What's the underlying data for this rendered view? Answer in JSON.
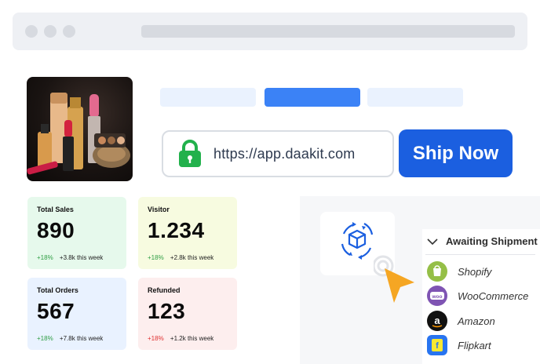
{
  "url_field": {
    "value": "https://app.daakit.com"
  },
  "ship_button": {
    "label": "Ship Now"
  },
  "stats": [
    {
      "label": "Total Sales",
      "value": "890",
      "change": "+18%",
      "change_color": "#2f9e44",
      "note": "+3.8k this week",
      "bg": "#e6f9ec"
    },
    {
      "label": "Visitor",
      "value": "1.234",
      "change": "+18%",
      "change_color": "#2f9e44",
      "note": "+2.8k this week",
      "bg": "#f7fbe0"
    },
    {
      "label": "Total Orders",
      "value": "567",
      "change": "+18%",
      "change_color": "#2f9e44",
      "note": "+7.8k this week",
      "bg": "#e9f2ff"
    },
    {
      "label": "Refunded",
      "value": "123",
      "change": "+18%",
      "change_color": "#e03131",
      "note": "+1.2k this week",
      "bg": "#fdeeee"
    }
  ],
  "shipment": {
    "title": "Awaiting Shipment",
    "marketplaces": [
      {
        "name": "Shopify",
        "icon": "shopify-icon",
        "color": "#95bf47"
      },
      {
        "name": "WooCommerce",
        "icon": "woocommerce-icon",
        "color": "#7f54b3"
      },
      {
        "name": "Amazon",
        "icon": "amazon-icon",
        "color": "#111111"
      },
      {
        "name": "Flipkart",
        "icon": "flipkart-icon",
        "color": "#2874f0"
      }
    ]
  },
  "colors": {
    "accent": "#1b5fe0",
    "lock": "#22b14c",
    "cursor": "#f5a623"
  }
}
